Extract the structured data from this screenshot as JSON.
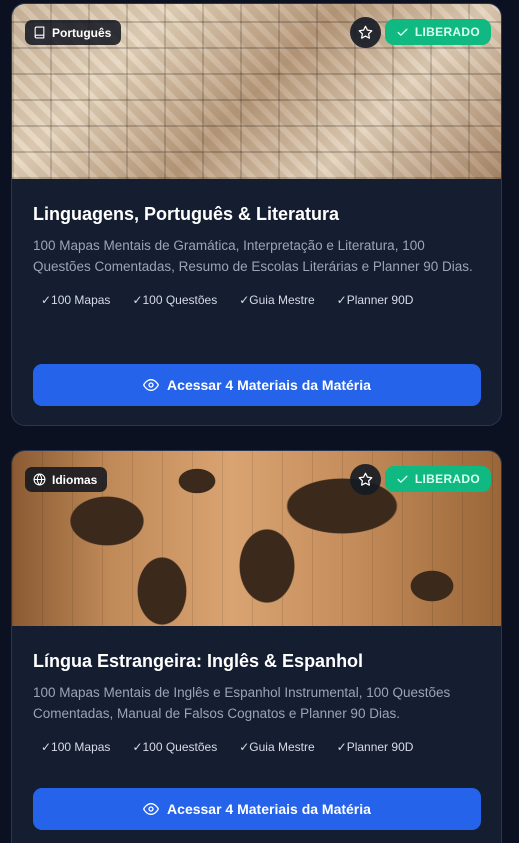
{
  "cards": [
    {
      "tag_label": "Português",
      "tag_icon": "book-icon",
      "status_label": "LIBERADO",
      "status_color": "#10b981",
      "title": "Linguagens, Português & Literatura",
      "description": "100 Mapas Mentais de Gramática, Interpretação e Literatura, 100 Questões Comentadas, Resumo de Escolas Literárias e Planner 90 Dias.",
      "features": [
        "✓100 Mapas",
        "✓100 Questões",
        "✓Guia Mestre",
        "✓Planner 90D"
      ],
      "cta_label": "Acessar 4 Materiais da Matéria"
    },
    {
      "tag_label": "Idiomas",
      "tag_icon": "globe-icon",
      "status_label": "LIBERADO",
      "status_color": "#10b981",
      "title": "Língua Estrangeira: Inglês & Espanhol",
      "description": "100 Mapas Mentais de Inglês e Espanhol Instrumental, 100 Questões Comentadas, Manual de Falsos Cognatos e Planner 90 Dias.",
      "features": [
        "✓100 Mapas",
        "✓100 Questões",
        "✓Guia Mestre",
        "✓Planner 90D"
      ],
      "cta_label": "Acessar 4 Materiais da Matéria"
    }
  ],
  "accent_color": "#2563eb"
}
